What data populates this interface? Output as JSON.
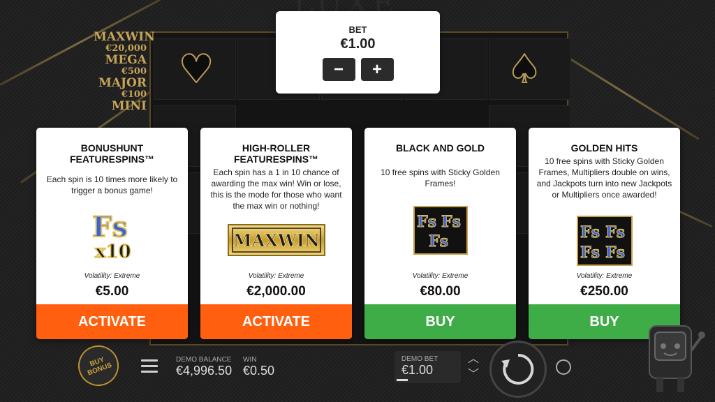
{
  "game": {
    "logo": "LUXE",
    "jackpots": [
      {
        "name": "MAXWIN",
        "value": "€20,000"
      },
      {
        "name": "MEGA",
        "value": "€500"
      },
      {
        "name": "MAJOR",
        "value": "€100"
      },
      {
        "name": "MINI",
        "value": ""
      }
    ]
  },
  "bet": {
    "label": "BET",
    "value": "€1.00",
    "decrease_label": "−",
    "increase_label": "+"
  },
  "cards": [
    {
      "title_line1": "BONUSHUNT",
      "title_line2": "FEATURESPINS™",
      "description": "Each spin is 10 times more likely to trigger a bonus game!",
      "image_text": "Fs x10",
      "volatility": "Volatility: Extreme",
      "price": "€5.00",
      "button": "ACTIVATE",
      "button_color": "#ff5f0f"
    },
    {
      "title_line1": "HIGH-ROLLER",
      "title_line2": "FEATURESPINS™",
      "description": "Each spin has a 1 in 10 chance of awarding the max win! Win or lose, this is the mode for those who want the max win or nothing!",
      "image_text": "MAXWIN",
      "volatility": "Volatility: Extreme",
      "price": "€2,000.00",
      "button": "ACTIVATE",
      "button_color": "#ff5f0f"
    },
    {
      "title_line1": "BLACK AND GOLD",
      "title_line2": "",
      "description": "10 free spins with Sticky Golden Frames!",
      "image_text": "FsFs Fs",
      "volatility": "Volatility: Extreme",
      "price": "€80.00",
      "button": "BUY",
      "button_color": "#3fad47"
    },
    {
      "title_line1": "GOLDEN HITS",
      "title_line2": "",
      "description": "10 free spins with Sticky Golden Frames, Multipliers double on wins, and Jackpots turn into new Jackpots or Multipliers once awarded!",
      "image_text": "FsFs FsFs",
      "volatility": "Volatility: Extreme",
      "price": "€250.00",
      "button": "BUY",
      "button_color": "#3fad47"
    }
  ],
  "bottom": {
    "buy_bonus_label": "BUY BONUS",
    "balance_label": "DEMO BALANCE",
    "balance_value": "€4,996.50",
    "win_label": "WIN",
    "win_value": "€0.50",
    "demo_bet_label": "DEMO BET",
    "demo_bet_value": "€1.00"
  },
  "colors": {
    "gold": "#c6a458",
    "activate": "#ff5f0f",
    "buy": "#3fad47"
  }
}
